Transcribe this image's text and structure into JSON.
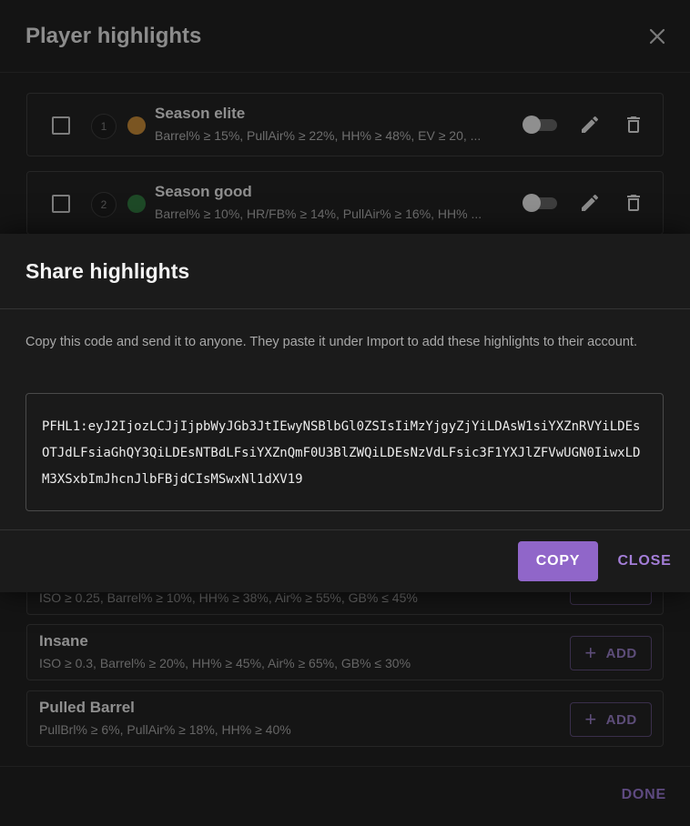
{
  "background_dialog": {
    "title": "Player highlights",
    "rules": [
      {
        "number": "1",
        "color": "#9a6a2a",
        "name": "Season elite",
        "description": "Barrel% ≥ 15%, PullAir% ≥ 22%, HH% ≥ 48%, EV ≥ 20, ..."
      },
      {
        "number": "2",
        "color": "#24522d",
        "name": "Season good",
        "description": "Barrel% ≥ 10%, HR/FB% ≥ 14%, PullAir% ≥ 16%, HH% ..."
      }
    ],
    "presets": [
      {
        "name": "",
        "description": "ISO ≥ 0.25, Barrel% ≥ 10%, HH% ≥ 38%, Air% ≥ 55%, GB% ≤ 45%",
        "add_label": "ADD"
      },
      {
        "name": "Insane",
        "description": "ISO ≥ 0.3, Barrel% ≥ 20%, HH% ≥ 45%, Air% ≥ 65%, GB% ≤ 30%",
        "add_label": "ADD"
      },
      {
        "name": "Pulled Barrel",
        "description": "PullBrl% ≥ 6%, PullAir% ≥ 18%, HH% ≥ 40%",
        "add_label": "ADD"
      }
    ],
    "done_label": "DONE"
  },
  "share_dialog": {
    "title": "Share highlights",
    "instructions": "Copy this code and send it to anyone. They paste it under Import to add these highlights to their account.",
    "code": "PFHL1:eyJ2IjozLCJjIjpbWyJGb3JtIEwyNSBlbGl0ZSIsIiMzYjgyZjYiLDAsW1siYXZnRVYiLDEsOTJdLFsiaGhQY3QiLDEsNTBdLFsiYXZnQmF0U3BlZWQiLDEsNzVdLFsic3F1YXJlZFVwUGN0IiwxLDM3XSxbImJhcnJlbFBjdCIsMSwxNl1dXV19",
    "copy_label": "COPY",
    "close_label": "CLOSE"
  },
  "colors": {
    "accent": "#9066c9",
    "accent_text": "#a47ed8"
  }
}
